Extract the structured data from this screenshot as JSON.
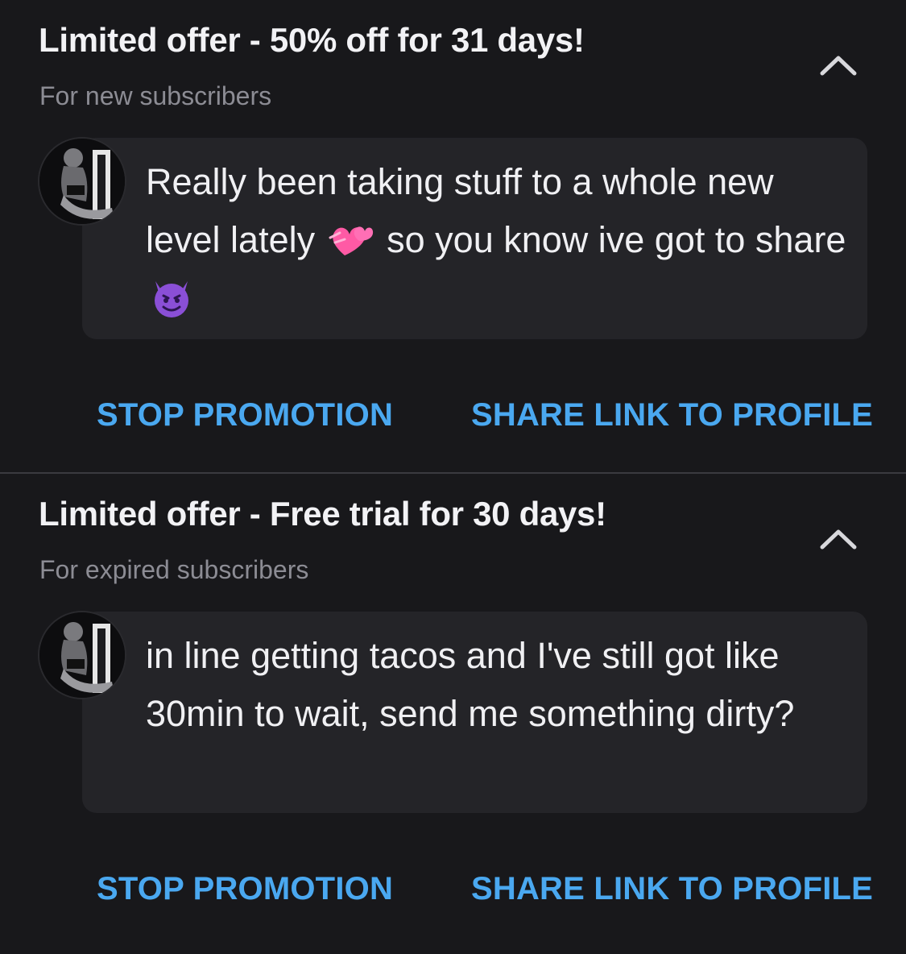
{
  "promotions": [
    {
      "title": "Limited offer - 50% off for 31 days!",
      "subtitle": "For new subscribers",
      "message_parts": [
        "Really been taking stuff to a whole new level lately",
        "so you know ive got to share"
      ],
      "message_emojis": [
        "two-hearts-emoji",
        "smiling-devil-emoji"
      ],
      "stop_label": "STOP PROMOTION",
      "share_label": "SHARE LINK TO PROFILE"
    },
    {
      "title": "Limited offer - Free trial for 30 days!",
      "subtitle": "For expired subscribers",
      "message": "in line getting tacos and I've still got like 30min to wait, send me something dirty?",
      "stop_label": "STOP PROMOTION",
      "share_label": "SHARE LINK TO PROFILE"
    }
  ],
  "colors": {
    "background": "#18181b",
    "bubble": "#242428",
    "accent": "#4aa8f0",
    "muted_text": "#8c8c94"
  },
  "icons": [
    "chevron-up-icon",
    "avatar"
  ]
}
